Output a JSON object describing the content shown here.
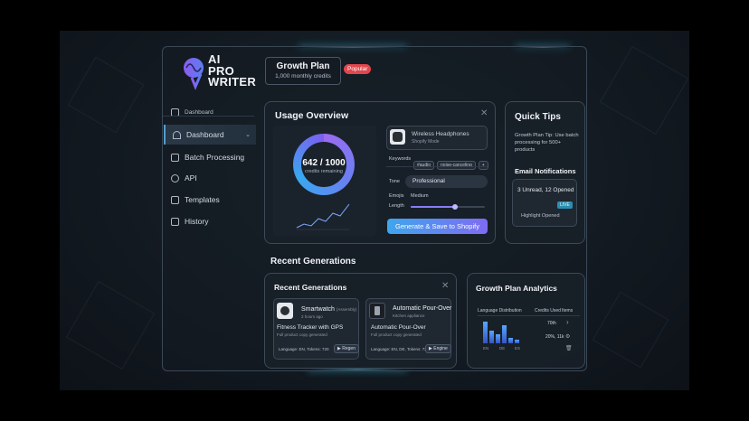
{
  "brand": {
    "line1": "AI",
    "line2": "PRO",
    "line3": "WRITER"
  },
  "plan": {
    "title": "Growth Plan",
    "subtitle": "1,000 monthly credits",
    "badge": "Popular"
  },
  "sidebar": {
    "items": [
      {
        "label": "Dashboard",
        "icon": "home-icon"
      },
      {
        "label": "Dashboard",
        "icon": "pulse-icon",
        "active": true
      },
      {
        "label": "Batch Processing",
        "icon": "layers-icon"
      },
      {
        "label": "API",
        "icon": "network-icon"
      },
      {
        "label": "Templates",
        "icon": "template-icon"
      },
      {
        "label": "History",
        "icon": "history-icon"
      }
    ]
  },
  "usage": {
    "title": "Usage Overview",
    "credits_used": "642 / 1000",
    "credits_label": "credits remaining",
    "product": {
      "name": "Wireless Headphones",
      "sub": "Shopify Mode"
    },
    "keywords_label": "Keywords",
    "keywords": [
      "#audio",
      "noise-canceling",
      "+"
    ],
    "tone_label": "Tone",
    "tone_value": "Professional",
    "emojis_label": "Emojis",
    "emojis_value": "Medium",
    "length_label": "Length",
    "length_level": 0.6,
    "generate_button": "Generate & Save to Shopify"
  },
  "tips": {
    "title": "Quick Tips",
    "tip": "Growth Plan Tip: Use batch processing for 500+ products",
    "email_title": "Email Notifications",
    "email_counts": "3 Unread, 12 Opened",
    "email_tag": "LIVE",
    "email_link": "Highlight Opened"
  },
  "recent": {
    "section_title": "Recent Generations",
    "panel_title": "Recent Generations",
    "items": [
      {
        "name": "Smartwatch",
        "tag": "(Assembly)",
        "meta": "2 hours ago",
        "title": "Fitness Tracker with GPS",
        "desc": "Full product copy generated",
        "footer": "Language: EN, Tokens: 720",
        "action": "Regen"
      },
      {
        "name": "Automatic Pour-Over",
        "tag": "",
        "meta": "Kitchen appliance",
        "title": "Automatic Pour-Over",
        "desc": "Full product copy generated",
        "footer": "Language: EN, DE, Tokens: 720",
        "action": "Engine"
      }
    ]
  },
  "analytics": {
    "title": "Growth Plan Analytics",
    "col_language": "Language Distribution",
    "col_credits": "Credits Used",
    "col_items": "Items",
    "rows": [
      {
        "credits": "70th",
        "items": ""
      },
      {
        "credits": "20%, 11k",
        "items": ""
      }
    ],
    "bar_labels": [
      "EN",
      "DE",
      "ES"
    ]
  },
  "colors": {
    "accent": "#31c3e8",
    "primary": "#7f6bf3",
    "danger": "#e0474d"
  }
}
